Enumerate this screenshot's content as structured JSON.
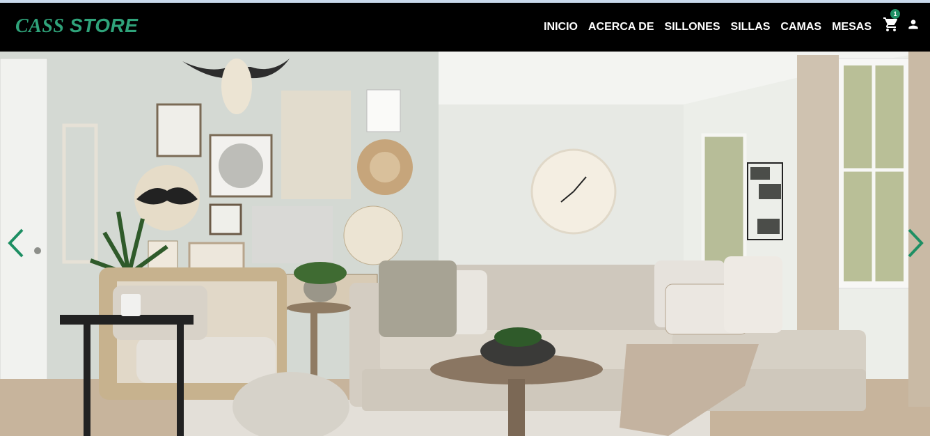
{
  "header": {
    "brand_part1": "CASS",
    "brand_part2": "STORE",
    "nav": [
      "INICIO",
      "ACERCA DE",
      "SILLONES",
      "SILLAS",
      "CAMAS",
      "MESAS"
    ],
    "cart_count": "1",
    "cart_icon": "cart-icon",
    "user_icon": "user-icon"
  },
  "hero": {
    "prev_icon": "chevron-left-icon",
    "next_icon": "chevron-right-icon"
  },
  "colors": {
    "accent": "#2fa37a",
    "nav_bg": "#000000",
    "badge": "#1d8f63"
  }
}
